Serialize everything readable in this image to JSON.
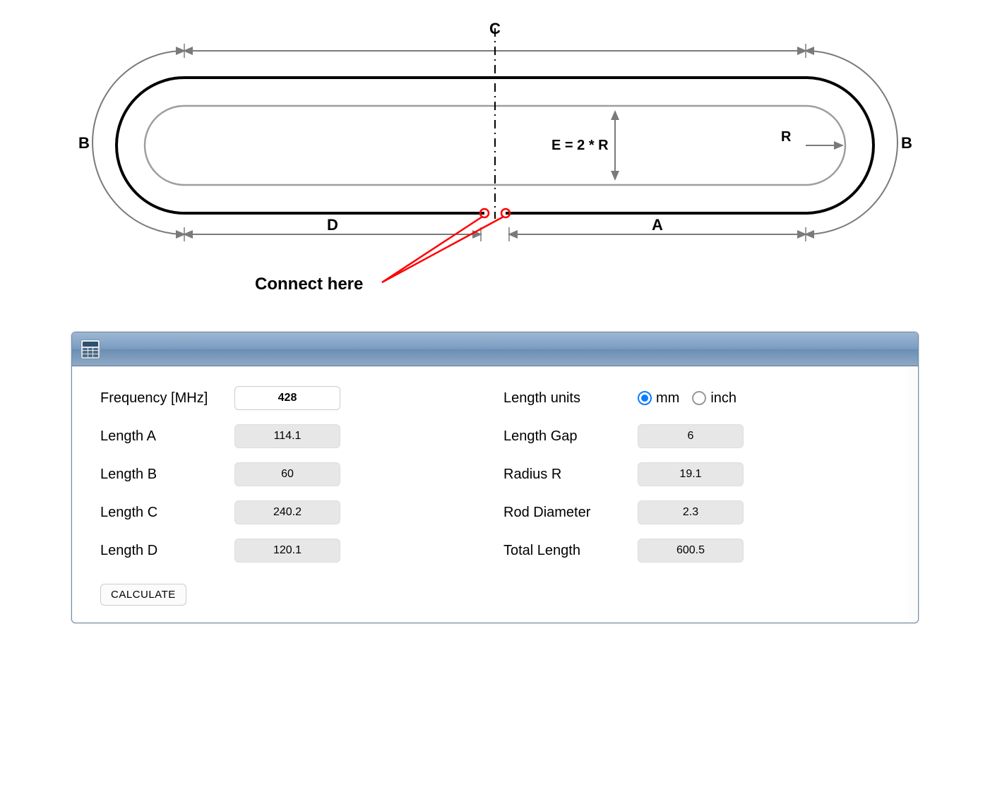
{
  "diagram": {
    "label_C": "C",
    "label_B_left": "B",
    "label_B_right": "B",
    "label_D": "D",
    "label_A": "A",
    "label_E": "E = 2 * R",
    "label_R": "R",
    "connect_label": "Connect here"
  },
  "calc": {
    "left": {
      "frequency_label": "Frequency [MHz]",
      "frequency_value": "428",
      "lengthA_label": "Length A",
      "lengthA_value": "114.1",
      "lengthB_label": "Length B",
      "lengthB_value": "60",
      "lengthC_label": "Length C",
      "lengthC_value": "240.2",
      "lengthD_label": "Length D",
      "lengthD_value": "120.1"
    },
    "right": {
      "units_label": "Length units",
      "unit_mm": "mm",
      "unit_inch": "inch",
      "gap_label": "Length Gap",
      "gap_value": "6",
      "radius_label": "Radius R",
      "radius_value": "19.1",
      "rod_label": "Rod Diameter",
      "rod_value": "2.3",
      "total_label": "Total Length",
      "total_value": "600.5"
    },
    "calculate_label": "CALCULATE"
  }
}
